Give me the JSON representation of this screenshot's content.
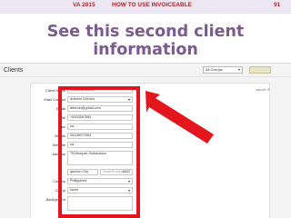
{
  "slide": {
    "header_left": "VA 2015",
    "header_mid": "HOW TO USE INVOICEABLE",
    "header_page": "91",
    "title": "See this second client information"
  },
  "app": {
    "title": "Clients",
    "group_filter": "All Groups",
    "cancel_label": "cancel ✕"
  },
  "form": {
    "client_name": {
      "label": "Client Name",
      "value": "Cerebral Coffee"
    },
    "main_contact": {
      "label": "Main Contact",
      "value": "Artemio Gordon"
    },
    "email": {
      "label": "Email",
      "value": "artemio@gmail.com"
    },
    "tel": {
      "label": "Tel",
      "value": "+6323567892"
    },
    "fax": {
      "label": "Fax",
      "value": "na"
    },
    "mobile": {
      "label": "Mobile",
      "value": "09128977654"
    },
    "website": {
      "label": "Website",
      "value": "na"
    },
    "address": {
      "label": "Address",
      "value": "75 Newport Subdivision"
    },
    "city": {
      "value": "quezon City"
    },
    "state": {
      "value": "State/Province"
    },
    "zip": {
      "value": "1002"
    },
    "country": {
      "label": "Country",
      "value": "Philippines"
    },
    "group": {
      "label": "Group",
      "value": "None"
    },
    "background": {
      "label": "Background",
      "value": ""
    }
  },
  "colors": {
    "accent_red": "#e4151c",
    "title_purple": "#7d5a8e",
    "header_red": "#c0212b"
  }
}
